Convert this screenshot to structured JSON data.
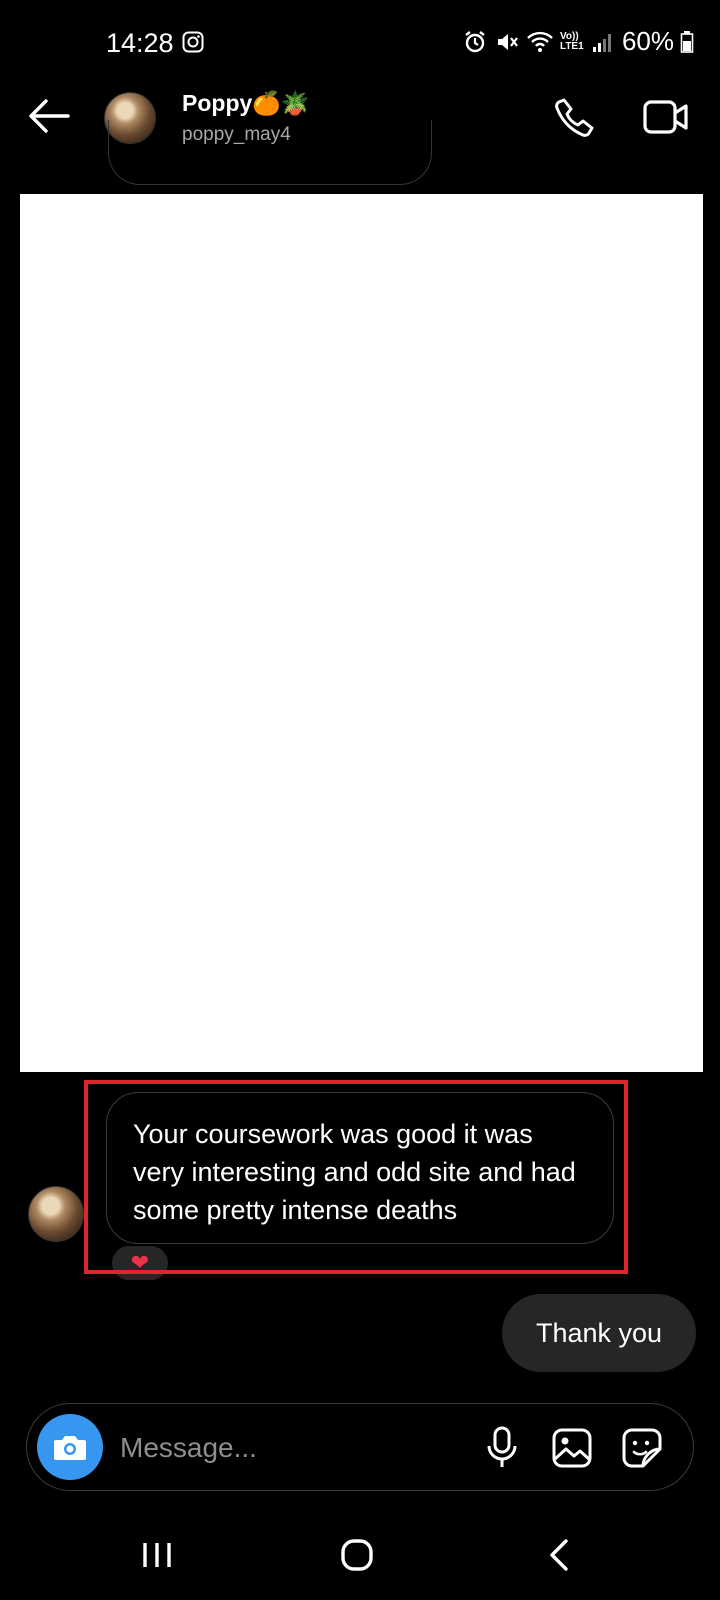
{
  "status_bar": {
    "time": "14:28",
    "battery_percent": "60%",
    "network_label": "Vo)) LTE1"
  },
  "header": {
    "name": "Poppy",
    "name_emojis": "🍊🪴",
    "handle": "poppy_may4"
  },
  "messages": {
    "received_text": "Your coursework was good it was very interesting and odd site and had some pretty intense deaths",
    "reaction": "❤",
    "sent_text": "Thank you"
  },
  "composer": {
    "placeholder": "Message..."
  },
  "icons": {
    "back": "arrow-left-icon",
    "call": "phone-icon",
    "video": "video-camera-icon",
    "camera": "camera-icon",
    "mic": "microphone-icon",
    "gallery": "image-icon",
    "sticker": "sticker-icon"
  },
  "colors": {
    "background": "#000000",
    "accent": "#3797f0",
    "highlight": "#e0242c",
    "sent_bubble": "#262626"
  }
}
